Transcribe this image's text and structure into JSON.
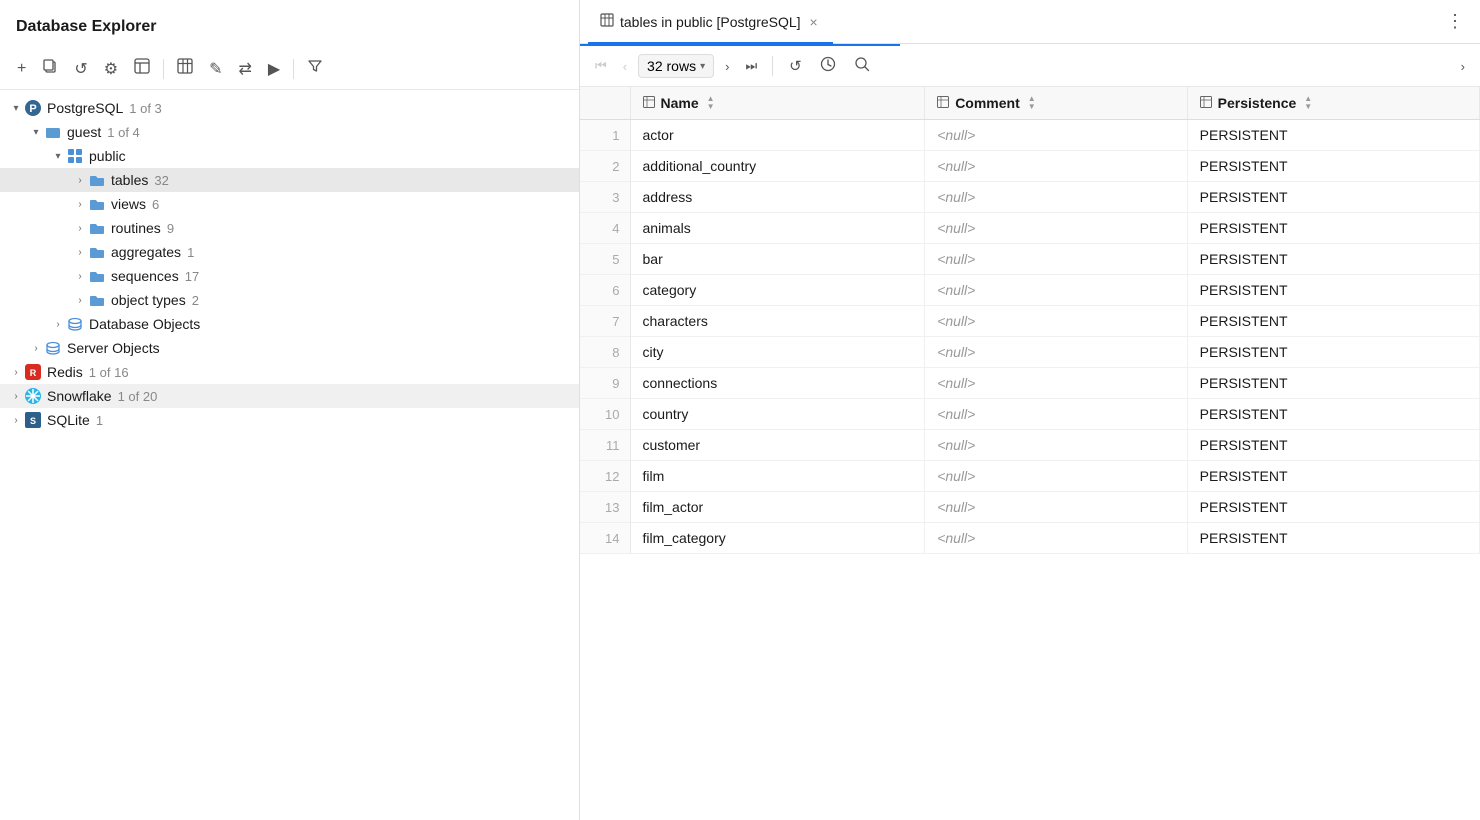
{
  "left_panel": {
    "title": "Database Explorer",
    "toolbar": {
      "add_label": "+",
      "copy_label": "⎘",
      "refresh_label": "↺",
      "settings_label": "⚙",
      "ui_label": "⊡",
      "table_label": "⊞",
      "edit_label": "✎",
      "transfer_label": "⇄",
      "run_label": "▶",
      "filter_label": "⊳"
    },
    "tree": [
      {
        "id": "postgres",
        "label": "PostgreSQL",
        "badge": "1 of 3",
        "icon": "postgres",
        "level": 0,
        "expanded": true,
        "children": [
          {
            "id": "guest",
            "label": "guest",
            "badge": "1 of 4",
            "icon": "folder-blue",
            "level": 1,
            "expanded": true,
            "children": [
              {
                "id": "public",
                "label": "public",
                "badge": "",
                "icon": "schema",
                "level": 2,
                "expanded": true,
                "children": [
                  {
                    "id": "tables",
                    "label": "tables",
                    "badge": "32",
                    "icon": "folder",
                    "level": 3,
                    "expanded": false,
                    "selected": true
                  },
                  {
                    "id": "views",
                    "label": "views",
                    "badge": "6",
                    "icon": "folder",
                    "level": 3,
                    "expanded": false
                  },
                  {
                    "id": "routines",
                    "label": "routines",
                    "badge": "9",
                    "icon": "folder",
                    "level": 3,
                    "expanded": false
                  },
                  {
                    "id": "aggregates",
                    "label": "aggregates",
                    "badge": "1",
                    "icon": "folder",
                    "level": 3,
                    "expanded": false
                  },
                  {
                    "id": "sequences",
                    "label": "sequences",
                    "badge": "17",
                    "icon": "folder",
                    "level": 3,
                    "expanded": false
                  },
                  {
                    "id": "object_types",
                    "label": "object types",
                    "badge": "2",
                    "icon": "folder",
                    "level": 3,
                    "expanded": false
                  }
                ]
              },
              {
                "id": "database_objects",
                "label": "Database Objects",
                "badge": "",
                "icon": "db-objects",
                "level": 2,
                "expanded": false
              }
            ]
          },
          {
            "id": "server_objects",
            "label": "Server Objects",
            "badge": "",
            "icon": "server",
            "level": 1,
            "expanded": false
          }
        ]
      },
      {
        "id": "redis",
        "label": "Redis",
        "badge": "1 of 16",
        "icon": "redis",
        "level": 0,
        "expanded": false
      },
      {
        "id": "snowflake",
        "label": "Snowflake",
        "badge": "1 of 20",
        "icon": "snowflake",
        "level": 0,
        "expanded": false
      },
      {
        "id": "sqlite",
        "label": "SQLite",
        "badge": "1",
        "icon": "sqlite",
        "level": 0,
        "expanded": false
      }
    ]
  },
  "tab_bar": {
    "tab_icon": "⊞",
    "tab_label": "tables in public [PostgreSQL]",
    "tab_close": "×",
    "more_icon": "⋮"
  },
  "result_toolbar": {
    "first_label": "⏮",
    "prev_label": "‹",
    "rows_label": "32 rows",
    "next_label": "›",
    "last_label": "⏭",
    "refresh_label": "↺",
    "clock_label": "🕐",
    "search_label": "🔍",
    "nav_right_label": "›"
  },
  "table": {
    "columns": [
      {
        "id": "row_num",
        "label": "#"
      },
      {
        "id": "name",
        "label": "Name",
        "icon": "⊞"
      },
      {
        "id": "comment",
        "label": "Comment",
        "icon": "⊞"
      },
      {
        "id": "persistence",
        "label": "Persistence",
        "icon": "⊞"
      }
    ],
    "rows": [
      {
        "num": 1,
        "name": "actor",
        "comment": "<null>",
        "persistence": "PERSISTENT"
      },
      {
        "num": 2,
        "name": "additional_country",
        "comment": "<null>",
        "persistence": "PERSISTENT"
      },
      {
        "num": 3,
        "name": "address",
        "comment": "<null>",
        "persistence": "PERSISTENT"
      },
      {
        "num": 4,
        "name": "animals",
        "comment": "<null>",
        "persistence": "PERSISTENT"
      },
      {
        "num": 5,
        "name": "bar",
        "comment": "<null>",
        "persistence": "PERSISTENT"
      },
      {
        "num": 6,
        "name": "category",
        "comment": "<null>",
        "persistence": "PERSISTENT"
      },
      {
        "num": 7,
        "name": "characters",
        "comment": "<null>",
        "persistence": "PERSISTENT"
      },
      {
        "num": 8,
        "name": "city",
        "comment": "<null>",
        "persistence": "PERSISTENT"
      },
      {
        "num": 9,
        "name": "connections",
        "comment": "<null>",
        "persistence": "PERSISTENT"
      },
      {
        "num": 10,
        "name": "country",
        "comment": "<null>",
        "persistence": "PERSISTENT"
      },
      {
        "num": 11,
        "name": "customer",
        "comment": "<null>",
        "persistence": "PERSISTENT"
      },
      {
        "num": 12,
        "name": "film",
        "comment": "<null>",
        "persistence": "PERSISTENT"
      },
      {
        "num": 13,
        "name": "film_actor",
        "comment": "<null>",
        "persistence": "PERSISTENT"
      },
      {
        "num": 14,
        "name": "film_category",
        "comment": "<null>",
        "persistence": "PERSISTENT"
      }
    ]
  }
}
